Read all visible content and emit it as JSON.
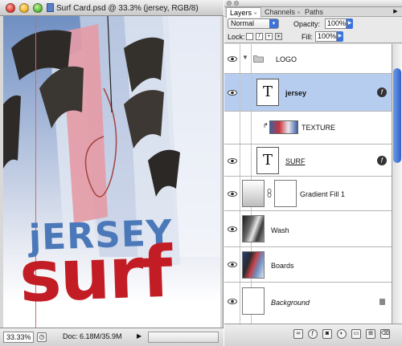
{
  "document_window": {
    "title": "Surf Card.psd @ 33.3% (jersey, RGB/8)",
    "canvas_text": {
      "line1": "jERSEY",
      "line2": "surf"
    },
    "status_bar": {
      "zoom": "33.33%",
      "doc_size": "Doc: 6.18M/35.9M"
    }
  },
  "layers_palette": {
    "tabs": [
      {
        "label": "Layers",
        "active": true
      },
      {
        "label": "Channels",
        "active": false
      },
      {
        "label": "Paths",
        "active": false
      }
    ],
    "blend_mode": "Normal",
    "opacity_label": "Opacity:",
    "opacity_value": "100%",
    "lock_label": "Lock:",
    "fill_label": "Fill:",
    "fill_value": "100%",
    "layers": [
      {
        "name": "LOGO",
        "kind": "group",
        "selected": false
      },
      {
        "name": "jersey",
        "kind": "text",
        "selected": true,
        "has_effects": true
      },
      {
        "name": "TEXTURE",
        "kind": "clipped",
        "selected": false
      },
      {
        "name": "SURF",
        "kind": "text",
        "selected": false,
        "has_effects": true
      },
      {
        "name": "Gradient Fill 1",
        "kind": "fill",
        "selected": false
      },
      {
        "name": "Wash",
        "kind": "image",
        "selected": false
      },
      {
        "name": "Boards",
        "kind": "image",
        "selected": false
      },
      {
        "name": "Background",
        "kind": "background",
        "selected": false,
        "locked": true
      }
    ]
  },
  "colors": {
    "selection": "#b7cdef",
    "accent_blue": "#3d73d8",
    "jersey_blue": "#4b78b8",
    "surf_red": "#c21d24"
  },
  "icons": [
    "eye-icon",
    "folder-icon",
    "text-layer-icon",
    "fx-icon",
    "lock-icon",
    "link-icon",
    "chain-icon"
  ]
}
